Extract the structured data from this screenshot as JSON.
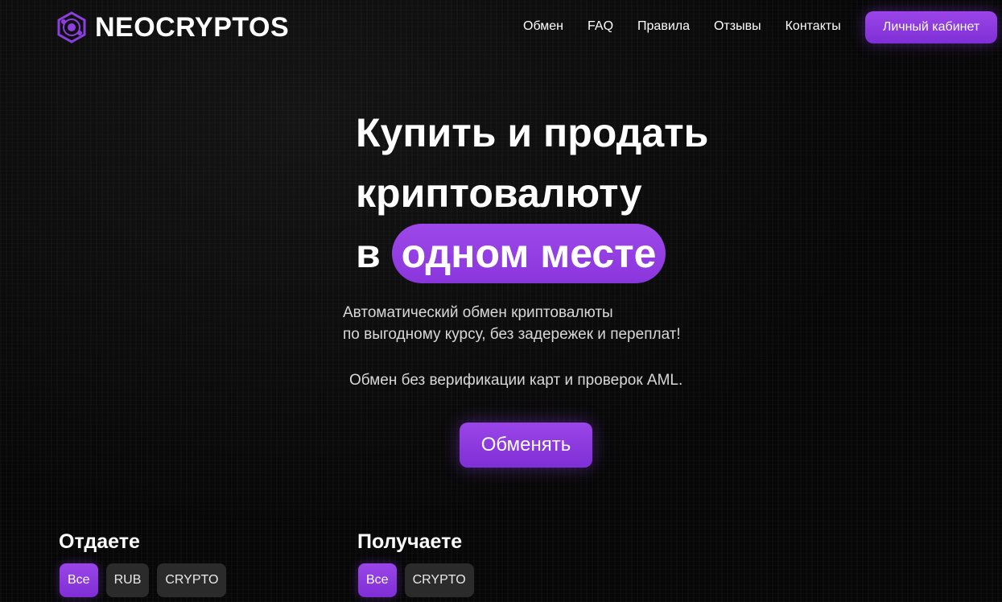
{
  "brand": {
    "name": "NEOCRYPTOS",
    "logo_icon": "atom-hexagon-icon",
    "accent": "#8b3fe0"
  },
  "nav": {
    "items": [
      "Обмен",
      "FAQ",
      "Правила",
      "Отзывы",
      "Контакты"
    ],
    "cabinet_label": "Личный кабинет"
  },
  "hero": {
    "line1": "Купить и продать",
    "line2": "криптовалюту",
    "line3_prefix": "в",
    "line3_highlight": "одном месте",
    "subtitle_line1": "Автоматический обмен криптовалюты",
    "subtitle_line2": "по выгодному курсу, без задережек и переплат!",
    "aml_note": "Обмен без верификации карт и проверок AML.",
    "cta_label": "Обменять"
  },
  "give": {
    "title": "Отдаете",
    "filters": [
      "Все",
      "RUB",
      "CRYPTO"
    ],
    "active_filter": "Все"
  },
  "receive": {
    "title": "Получаете",
    "filters": [
      "Все",
      "CRYPTO"
    ],
    "active_filter": "Все"
  }
}
